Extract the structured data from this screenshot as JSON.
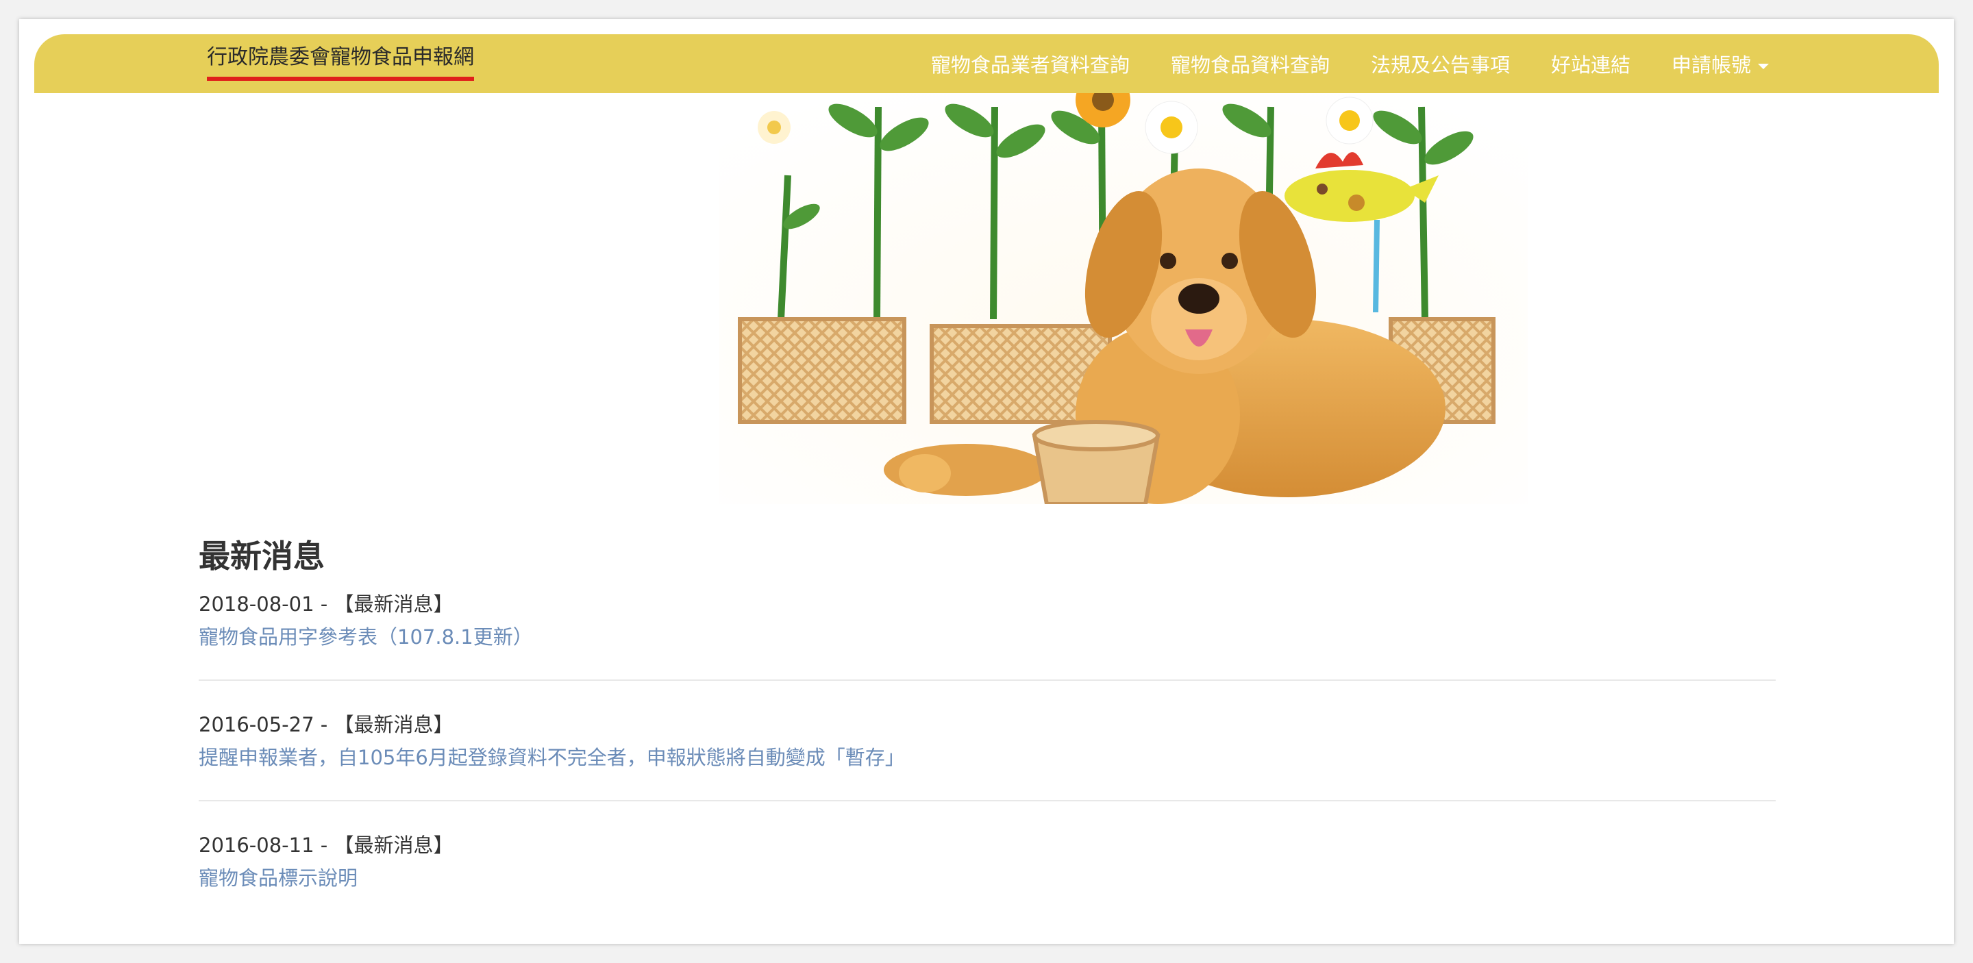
{
  "navbar": {
    "brand": "行政院農委會寵物食品申報網",
    "links": [
      {
        "label": "寵物食品業者資料查詢"
      },
      {
        "label": "寵物食品資料查詢"
      },
      {
        "label": "法規及公告事項"
      },
      {
        "label": "好站連結"
      },
      {
        "label": "申請帳號",
        "dropdown": true
      }
    ]
  },
  "banner": {
    "subject": "golden-retriever-with-sunflowers"
  },
  "news": {
    "title": "最新消息",
    "items": [
      {
        "date": "2018-08-01",
        "category": "【最新消息】",
        "title": "寵物食品用字參考表（107.8.1更新）"
      },
      {
        "date": "2016-05-27",
        "category": "【最新消息】",
        "title": "提醒申報業者，自105年6月起登錄資料不完全者，申報狀態將自動變成「暫存」"
      },
      {
        "date": "2016-08-11",
        "category": "【最新消息】",
        "title": "寵物食品標示說明"
      }
    ]
  },
  "colors": {
    "navbar": "#e6cf58",
    "brand_underline": "#e0201b",
    "link": "#6b8cb8"
  }
}
